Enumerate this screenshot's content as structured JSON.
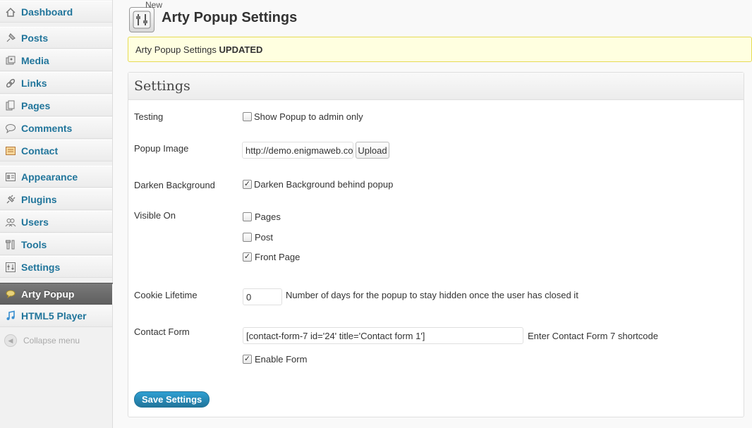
{
  "sidebar": {
    "items": [
      {
        "label": "Dashboard",
        "icon": "dashboard-icon"
      },
      {
        "label": "Posts",
        "icon": "pin-icon"
      },
      {
        "label": "Media",
        "icon": "media-icon"
      },
      {
        "label": "Links",
        "icon": "link-icon"
      },
      {
        "label": "Pages",
        "icon": "pages-icon"
      },
      {
        "label": "Comments",
        "icon": "comment-icon"
      },
      {
        "label": "Contact",
        "icon": "contact-icon"
      },
      {
        "label": "Appearance",
        "icon": "appearance-icon"
      },
      {
        "label": "Plugins",
        "icon": "plugin-icon"
      },
      {
        "label": "Users",
        "icon": "users-icon"
      },
      {
        "label": "Tools",
        "icon": "tools-icon"
      },
      {
        "label": "Settings",
        "icon": "settings-icon"
      },
      {
        "label": "Arty Popup",
        "icon": "speech-bubble-icon",
        "active": true
      },
      {
        "label": "HTML5 Player",
        "icon": "music-note-icon"
      }
    ],
    "collapse_label": "Collapse menu"
  },
  "header": {
    "new_tag": "New",
    "title": "Arty Popup Settings"
  },
  "notice": {
    "text": "Arty Popup Settings",
    "strong": "UPDATED"
  },
  "panel": {
    "title": "Settings",
    "testing": {
      "label": "Testing",
      "checkbox_label": "Show Popup to admin only",
      "checked": false
    },
    "popup_image": {
      "label": "Popup Image",
      "value": "http://demo.enigmaweb.com",
      "button": "Upload"
    },
    "darken": {
      "label": "Darken Background",
      "checkbox_label": "Darken Background behind popup",
      "checked": true
    },
    "visible_on": {
      "label": "Visible On",
      "options": [
        {
          "label": "Pages",
          "checked": false
        },
        {
          "label": "Post",
          "checked": false
        },
        {
          "label": "Front Page",
          "checked": true
        }
      ]
    },
    "cookie": {
      "label": "Cookie Lifetime",
      "value": "0",
      "help": "Number of days for the popup to stay hidden once the user has closed it"
    },
    "contact_form": {
      "label": "Contact Form",
      "value": "[contact-form-7 id='24' title='Contact form 1']",
      "help": "Enter Contact Form 7 shortcode",
      "enable_label": "Enable Form",
      "enabled": true
    },
    "save_button": "Save Settings"
  },
  "colors": {
    "link": "#21759b",
    "notice_bg": "#ffffe0",
    "notice_border": "#e6db55",
    "primary": "#21759b"
  }
}
